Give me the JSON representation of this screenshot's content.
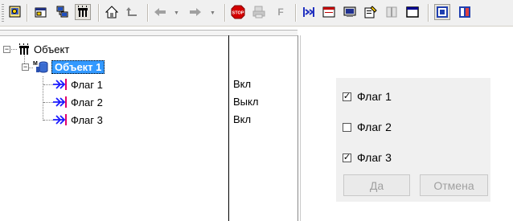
{
  "toolbar": {
    "buttons": [
      {
        "name": "view-icon"
      },
      {
        "name": "properties-icon"
      },
      {
        "name": "network-icon"
      },
      {
        "name": "object-tree-icon"
      },
      {
        "name": "home-icon"
      },
      {
        "name": "up-level-icon"
      },
      {
        "name": "back-icon"
      },
      {
        "name": "forward-icon"
      },
      {
        "name": "stop-icon"
      },
      {
        "name": "print-icon"
      },
      {
        "name": "filter-icon"
      },
      {
        "name": "flags-icon"
      },
      {
        "name": "form-icon"
      },
      {
        "name": "computer-icon"
      },
      {
        "name": "settings-icon"
      },
      {
        "name": "book-icon"
      },
      {
        "name": "window-icon"
      },
      {
        "name": "object-view-icon"
      },
      {
        "name": "report-icon"
      }
    ],
    "stop_label": "STOP",
    "filter_label": "F"
  },
  "tree": {
    "root": {
      "label": "Объект"
    },
    "child": {
      "label": "Объект 1",
      "icon_letter": "M"
    },
    "flags": [
      {
        "label": "Флаг 1",
        "value": "Вкл"
      },
      {
        "label": "Флаг 2",
        "value": "Выкл"
      },
      {
        "label": "Флаг 3",
        "value": "Вкл"
      }
    ]
  },
  "dialog": {
    "checkboxes": [
      {
        "label": "Флаг 1",
        "checked": true
      },
      {
        "label": "Флаг 2",
        "checked": false
      },
      {
        "label": "Флаг 3",
        "checked": true
      }
    ],
    "ok_label": "Да",
    "cancel_label": "Отмена"
  },
  "colors": {
    "selection": "#3399ff",
    "flag_arrow": "#1a1aff",
    "flag_bar": "#e0006e"
  }
}
